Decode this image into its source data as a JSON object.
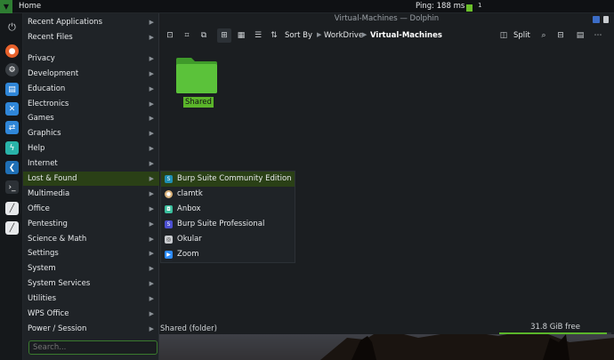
{
  "top_panel": {
    "home_label": "Home",
    "ping": "Ping: 188 ms",
    "workspace": "1"
  },
  "app_menu": {
    "items": [
      {
        "label": "Recent Applications"
      },
      {
        "label": "Recent Files"
      },
      {
        "label": "Privacy"
      },
      {
        "label": "Development"
      },
      {
        "label": "Education"
      },
      {
        "label": "Electronics"
      },
      {
        "label": "Games"
      },
      {
        "label": "Graphics"
      },
      {
        "label": "Help"
      },
      {
        "label": "Internet"
      },
      {
        "label": "Lost & Found"
      },
      {
        "label": "Multimedia"
      },
      {
        "label": "Office"
      },
      {
        "label": "Pentesting"
      },
      {
        "label": "Science & Math"
      },
      {
        "label": "Settings"
      },
      {
        "label": "System"
      },
      {
        "label": "System Services"
      },
      {
        "label": "Utilities"
      },
      {
        "label": "WPS Office"
      },
      {
        "label": "Power / Session"
      }
    ],
    "active_index": 10,
    "search_placeholder": "Search..."
  },
  "submenu": {
    "items": [
      {
        "label": "Burp Suite Community Edition",
        "icon": "burp-icon",
        "color": "#1f8fb5"
      },
      {
        "label": "clamtk",
        "icon": "clamtk-icon",
        "color": "#d9b27a"
      },
      {
        "label": "Anbox",
        "icon": "anbox-icon",
        "color": "#3bbf9e"
      },
      {
        "label": "Burp Suite Professional",
        "icon": "burp-pro-icon",
        "color": "#4b4fd1"
      },
      {
        "label": "Okular",
        "icon": "okular-icon",
        "color": "#c9ccd0"
      },
      {
        "label": "Zoom",
        "icon": "zoom-icon",
        "color": "#2d8cff"
      }
    ]
  },
  "dolphin": {
    "title": "Virtual-Machines — Dolphin",
    "sort_by": "Sort By",
    "breadcrumb": [
      "WorkDrive",
      "Virtual-Machines"
    ],
    "split_label": "Split",
    "folder": {
      "name": "Shared"
    },
    "status_text": "Shared (folder)",
    "free_space": "31.8 GiB free",
    "used_fraction": 0.96
  },
  "colors": {
    "accent": "#5bb52a",
    "menu_bg": "#1f2327",
    "panel_bg": "#0f1114"
  }
}
